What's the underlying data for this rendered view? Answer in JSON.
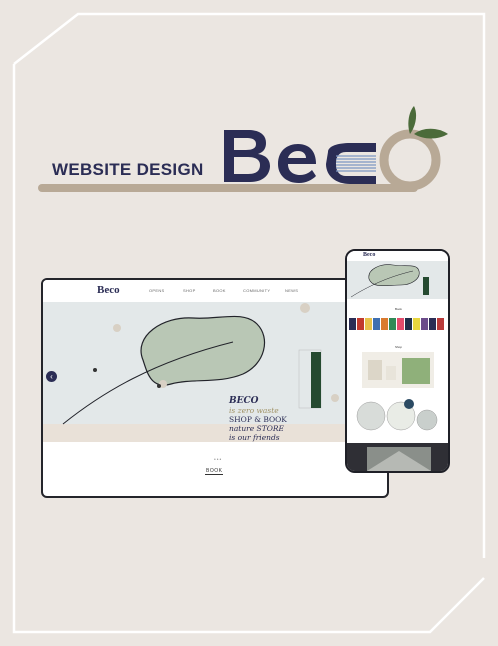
{
  "header": {
    "title": "WEBSITE DESIGN",
    "brand": "Beco"
  },
  "desktop": {
    "logo": "Beco",
    "nav": [
      "OPENS",
      "SHOP",
      "BOOK",
      "COMMUNITY",
      "NEWS"
    ],
    "hero": {
      "line1": "BECO",
      "line2": "is zero waste",
      "line3": "SHOP & BOOK",
      "line4": "nature STORE",
      "line5": "is our friends"
    },
    "prev_arrow": "‹",
    "carousel_dots": "•••",
    "section_label": "BOOK"
  },
  "phone": {
    "logo": "Beco",
    "section1": "Book",
    "section2": "Shop"
  },
  "colors": {
    "navy": "#2b2d55",
    "tan": "#b8a996",
    "leaf_green": "#4b6b3a",
    "background": "#ebe6e1"
  }
}
